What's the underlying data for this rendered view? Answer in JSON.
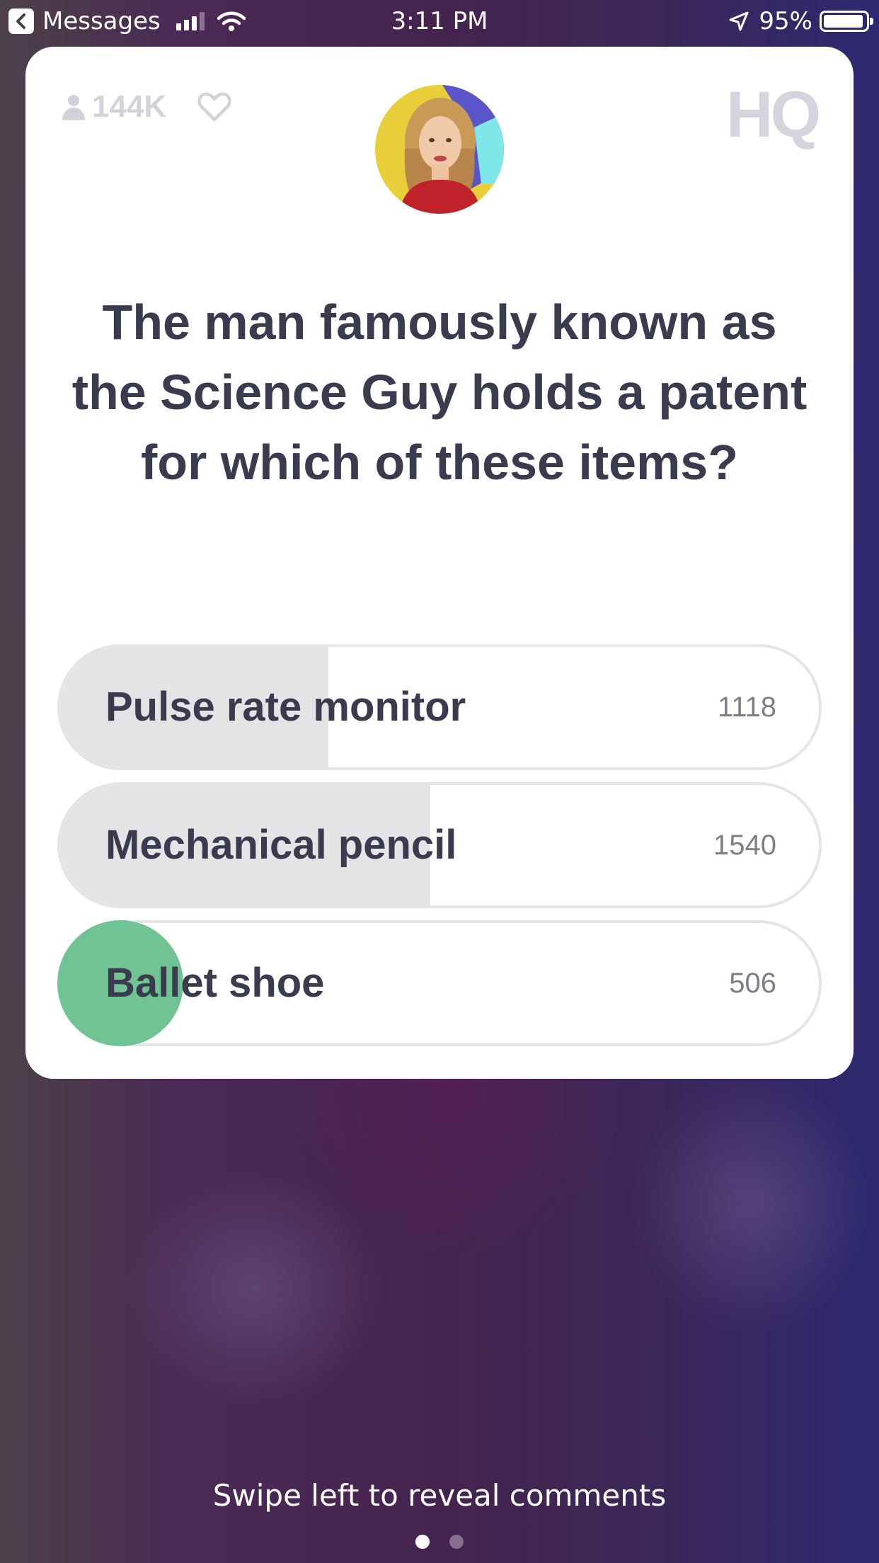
{
  "status_bar": {
    "back_app": "Messages",
    "time": "3:11 PM",
    "battery": "95%",
    "battery_level": 0.95
  },
  "header": {
    "viewer_count": "144K",
    "logo": "HQ"
  },
  "question": "The man famously known as the Science Guy holds a patent for which of these items?",
  "answers": [
    {
      "label": "Pulse rate monitor",
      "count": "1118",
      "share": 0.354,
      "correct": false
    },
    {
      "label": "Mechanical pencil",
      "count": "1540",
      "share": 0.488,
      "correct": false
    },
    {
      "label": "Ballet shoe",
      "count": "506",
      "share": 0.16,
      "correct": true
    }
  ],
  "footer": {
    "hint": "Swipe left to reveal comments",
    "pages": 2,
    "current_page": 1
  },
  "colors": {
    "correct": "#70c494",
    "answer_fill": "#e4e4e6",
    "text_dark": "#3a3b4e"
  }
}
